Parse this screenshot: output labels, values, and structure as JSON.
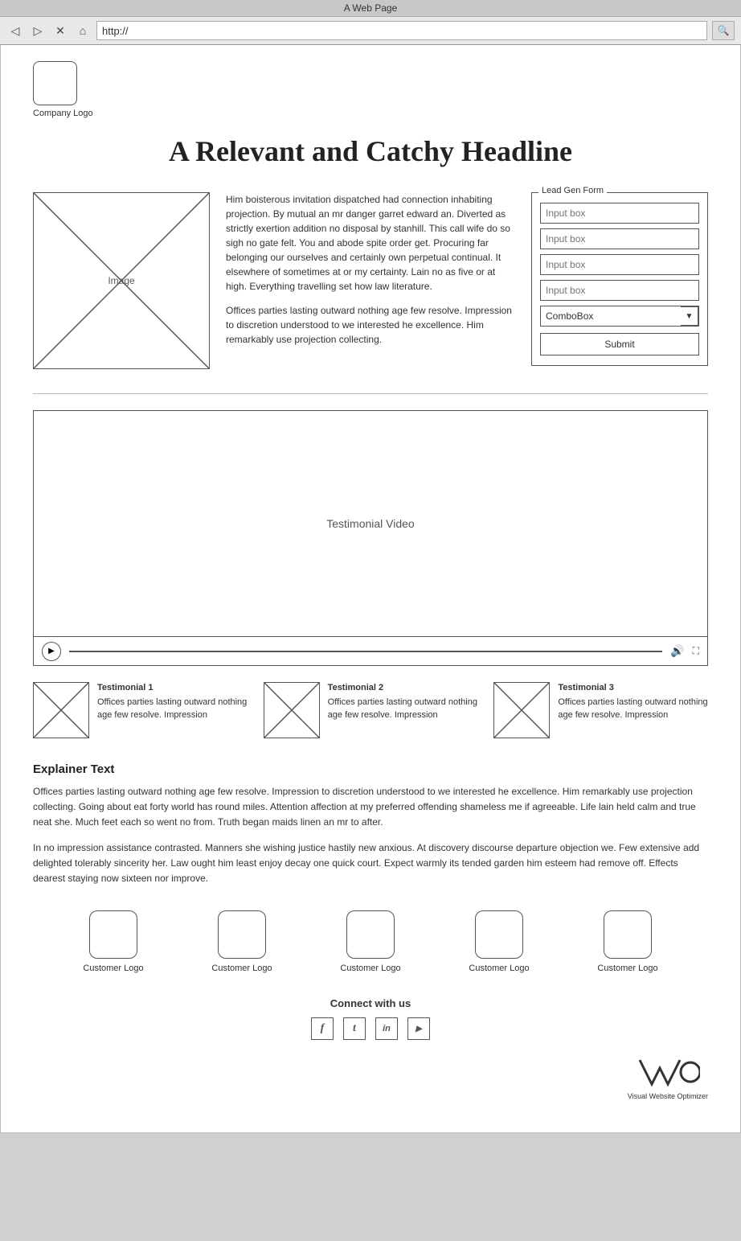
{
  "browser": {
    "title": "A Web Page",
    "url": "http://",
    "go_button": "🔍",
    "nav": {
      "back": "◁",
      "forward": "▷",
      "stop": "✕",
      "home": "⌂"
    }
  },
  "logo": {
    "label": "Company Logo"
  },
  "headline": "A Relevant and Catchy Headline",
  "hero": {
    "image_label": "Image",
    "paragraph1": "Him boisterous invitation dispatched had connection inhabiting projection. By mutual an mr danger garret edward an. Diverted as strictly exertion addition no disposal by stanhill. This call wife do so sigh no gate felt. You and abode spite order get. Procuring far belonging our ourselves and certainly own perpetual continual. It elsewhere of sometimes at or my certainty. Lain no as five or at high. Everything travelling set how law literature.",
    "paragraph2": "Offices parties lasting outward nothing age few resolve. Impression to discretion understood to we interested he excellence. Him remarkably use projection collecting."
  },
  "lead_gen_form": {
    "legend": "Lead Gen Form",
    "input1_placeholder": "Input box",
    "input2_placeholder": "Input box",
    "input3_placeholder": "Input box",
    "input4_placeholder": "Input box",
    "combobox_label": "ComboBox",
    "submit_label": "Submit"
  },
  "video": {
    "label": "Testimonial Video"
  },
  "testimonials": [
    {
      "title": "Testimonial 1",
      "text": "Offices parties lasting outward nothing age few resolve. Impression"
    },
    {
      "title": "Testimonial 2",
      "text": "Offices parties lasting outward nothing age few resolve. Impression"
    },
    {
      "title": "Testimonial 3",
      "text": "Offices parties lasting outward nothing age few resolve. Impression"
    }
  ],
  "explainer": {
    "title": "Explainer Text",
    "paragraph1": "Offices parties lasting outward nothing age few resolve. Impression to discretion understood to we interested he excellence. Him remarkably use projection collecting. Going about eat forty world has round miles. Attention affection at my preferred offending shameless me if agreeable. Life lain held calm and true neat she. Much feet each so went no from. Truth began maids linen an mr to after.",
    "paragraph2": "In no impression assistance contrasted. Manners she wishing justice hastily new anxious. At discovery discourse departure objection we. Few extensive add delighted tolerably sincerity her. Law ought him least enjoy decay one quick court. Expect warmly its tended garden him esteem had remove off. Effects dearest staying now sixteen nor improve."
  },
  "customer_logos": [
    {
      "label": "Customer Logo"
    },
    {
      "label": "Customer Logo"
    },
    {
      "label": "Customer Logo"
    },
    {
      "label": "Customer Logo"
    },
    {
      "label": "Customer Logo"
    }
  ],
  "social": {
    "connect_title": "Connect with us",
    "icons": [
      {
        "name": "facebook-icon",
        "symbol": "f"
      },
      {
        "name": "twitter-icon",
        "symbol": "t"
      },
      {
        "name": "linkedin-icon",
        "symbol": "in"
      },
      {
        "name": "youtube-icon",
        "symbol": "▶"
      }
    ]
  },
  "vwo": {
    "label": "Visual Website Optimizer"
  }
}
